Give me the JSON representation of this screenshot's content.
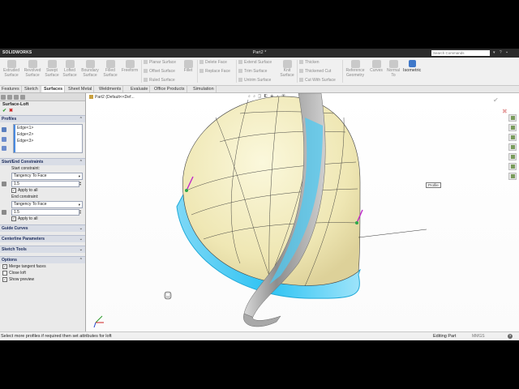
{
  "app": {
    "logo": "SOLIDWORKS",
    "doc_title": "Part2 *",
    "search_placeholder": "Search Commands"
  },
  "ribbon": {
    "big_buttons": [
      {
        "label": "Extruded\nSurface"
      },
      {
        "label": "Revolved\nSurface"
      },
      {
        "label": "Swept\nSurface"
      },
      {
        "label": "Lofted\nSurface"
      },
      {
        "label": "Boundary\nSurface"
      },
      {
        "label": "Filled\nSurface"
      },
      {
        "label": "Freeform"
      }
    ],
    "col1": [
      "Planar Surface",
      "Offset Surface",
      "Ruled Surface"
    ],
    "fillet": "Fillet",
    "col2": [
      "Delete Face",
      "Replace Face"
    ],
    "col3": [
      "Extend Surface",
      "Trim Surface",
      "Untrim Surface"
    ],
    "knit": "Knit\nSurface",
    "col4": [
      "Thicken",
      "Thickened Cut",
      "Cut With Surface"
    ],
    "reference": "Reference\nGeometry",
    "curves": "Curves",
    "normal_to": "Normal\nTo",
    "isometric": "Isometric"
  },
  "tabs": [
    "Features",
    "Sketch",
    "Surfaces",
    "Sheet Metal",
    "Weldments",
    "Evaluate",
    "Office Products",
    "Simulation"
  ],
  "active_tab": "Surfaces",
  "pm": {
    "title": "Surface-Loft",
    "profiles_header": "Profiles",
    "profiles": [
      "Edge<1>",
      "Edge<2>",
      "Edge<3>"
    ],
    "constraints_header": "Start/End Constraints",
    "start_label": "Start constraint:",
    "start_value": "Tangency To Face",
    "start_num": "1.5",
    "apply_all_1": "Apply to all",
    "end_label": "End constraint:",
    "end_value": "Tangency To Face",
    "end_num": "1.5",
    "apply_all_2": "Apply to all",
    "guide_header": "Guide Curves",
    "centerline_header": "Centerline Parameters",
    "sketch_tools_header": "Sketch Tools",
    "options_header": "Options",
    "options": [
      {
        "label": "Merge tangent faces",
        "checked": true
      },
      {
        "label": "Close loft",
        "checked": false
      },
      {
        "label": "Show preview",
        "checked": true
      }
    ]
  },
  "viewport": {
    "tree_label": "Part2  (Default<<Def...",
    "callout": "Profile"
  },
  "status": {
    "message": "Select more profiles if required then set attributes for loft",
    "mode": "Editing Part",
    "units": "MMGS"
  }
}
